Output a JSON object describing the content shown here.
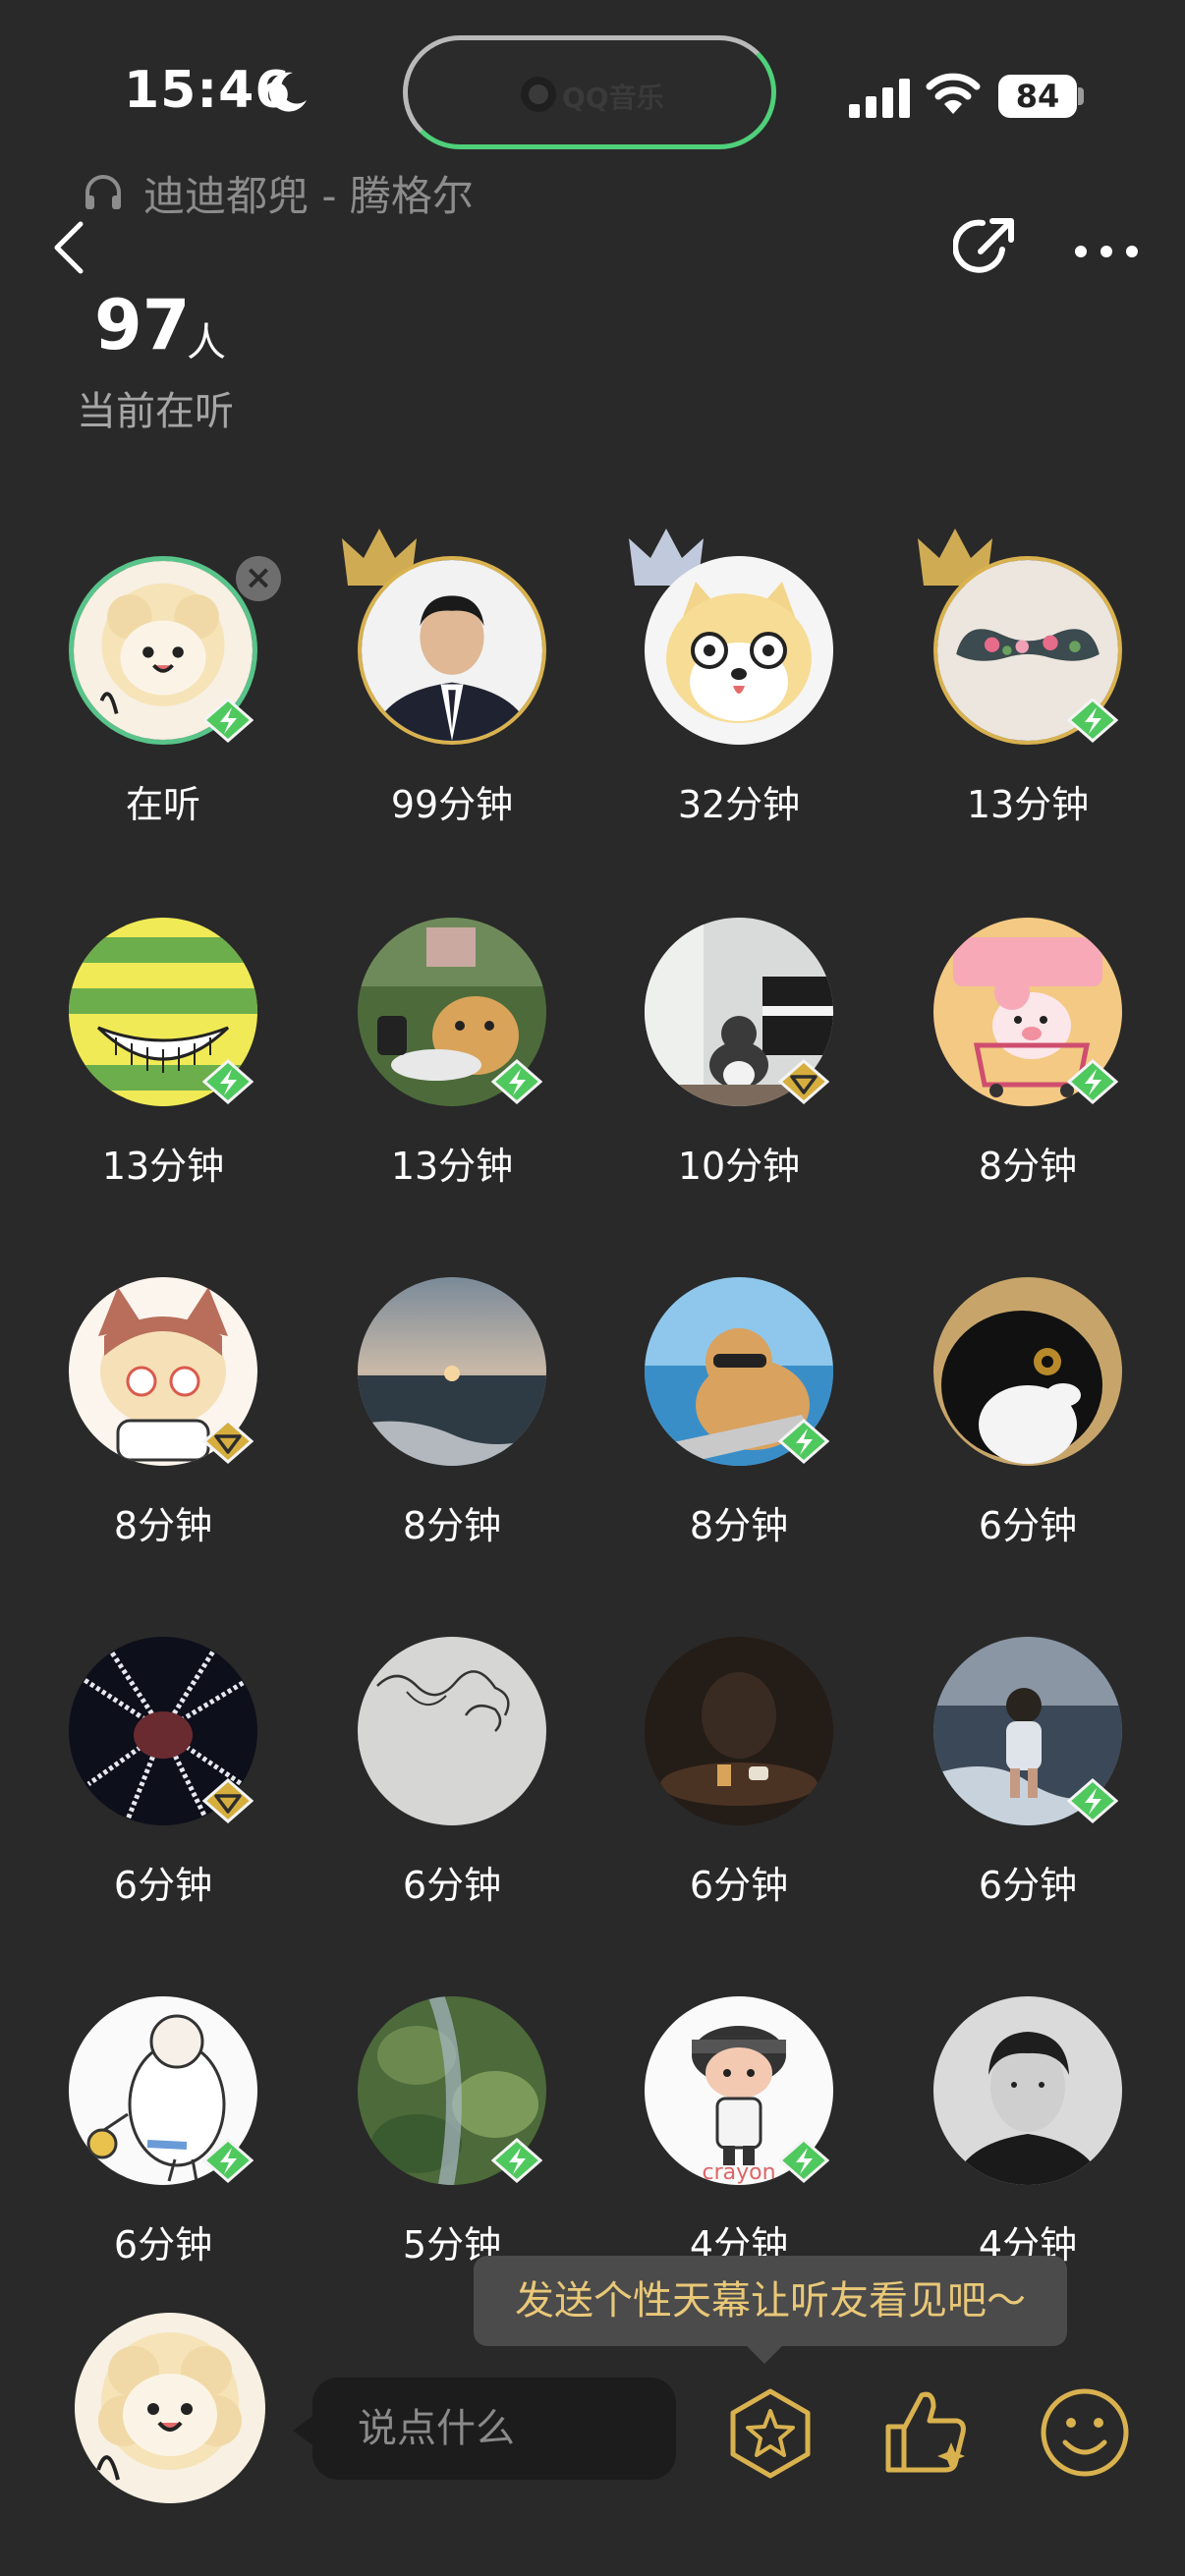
{
  "status_bar": {
    "time": "15:46",
    "dynamic_island_app": "QQ音乐",
    "battery": "84"
  },
  "header": {
    "song": "迪迪都兜 - 腾格尔",
    "listener_count": "97",
    "listener_unit": "人",
    "listener_label": "当前在听"
  },
  "listeners": [
    {
      "label": "在听",
      "badge": "lightning"
    },
    {
      "label": "99分钟",
      "badge": "none",
      "crown": "gold"
    },
    {
      "label": "32分钟",
      "badge": "none",
      "crown": "silver"
    },
    {
      "label": "13分钟",
      "badge": "lightning",
      "crown": "gold"
    },
    {
      "label": "13分钟",
      "badge": "lightning"
    },
    {
      "label": "13分钟",
      "badge": "lightning"
    },
    {
      "label": "10分钟",
      "badge": "diamond"
    },
    {
      "label": "8分钟",
      "badge": "lightning"
    },
    {
      "label": "8分钟",
      "badge": "diamond"
    },
    {
      "label": "8分钟",
      "badge": "none"
    },
    {
      "label": "8分钟",
      "badge": "lightning"
    },
    {
      "label": "6分钟",
      "badge": "none"
    },
    {
      "label": "6分钟",
      "badge": "diamond"
    },
    {
      "label": "6分钟",
      "badge": "none"
    },
    {
      "label": "6分钟",
      "badge": "none"
    },
    {
      "label": "6分钟",
      "badge": "lightning"
    },
    {
      "label": "6分钟",
      "badge": "lightning"
    },
    {
      "label": "5分钟",
      "badge": "lightning"
    },
    {
      "label": "4分钟",
      "badge": "lightning"
    },
    {
      "label": "4分钟",
      "badge": "none"
    }
  ],
  "avatar_texts": {
    "crayon": "crayon"
  },
  "bottom": {
    "tooltip": "发送个性天幕让听友看见吧～",
    "chat_placeholder": "说点什么"
  },
  "colors": {
    "background": "#292929",
    "accent_green": "#4fd07a",
    "gold": "#d9b24f",
    "tooltip_text": "#e9c878"
  }
}
